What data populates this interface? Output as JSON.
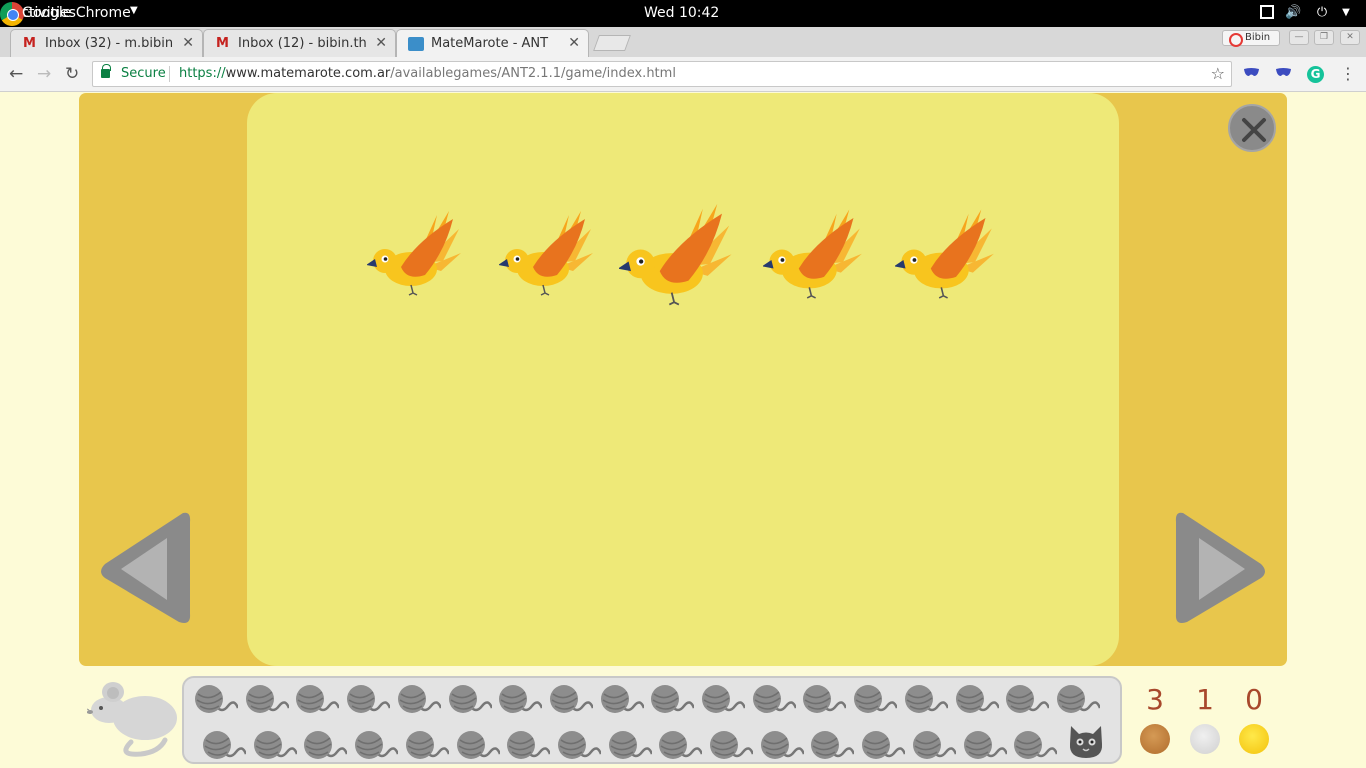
{
  "system_bar": {
    "activities": "Activities",
    "app_name": "Google Chrome",
    "clock": "Wed 10:42"
  },
  "browser": {
    "tabs": [
      {
        "label": "Inbox (32) - m.bibin",
        "icon": "gmail-icon",
        "active": false
      },
      {
        "label": "Inbox (12) - bibin.th",
        "icon": "gmail-icon",
        "active": false
      },
      {
        "label": "MateMarote - ANT",
        "icon": "matemarote-icon",
        "active": true
      }
    ],
    "profile_label": "Bibin",
    "secure_label": "Secure",
    "url_scheme": "https://",
    "url_host": "www.matemarote.com.ar",
    "url_path": "/availablegames/ANT2.1.1/game/index.html"
  },
  "game": {
    "bird_count": 5,
    "colors": {
      "board": "#e8c64c",
      "panel": "#eee978",
      "page": "#fdfbd7",
      "nav_button": "#8a8a8a",
      "score_text": "#a8482c"
    },
    "progress": {
      "yarn_row1": 18,
      "yarn_row2": 17
    },
    "scores": {
      "bronze": "3",
      "silver": "1",
      "gold": "0"
    }
  }
}
